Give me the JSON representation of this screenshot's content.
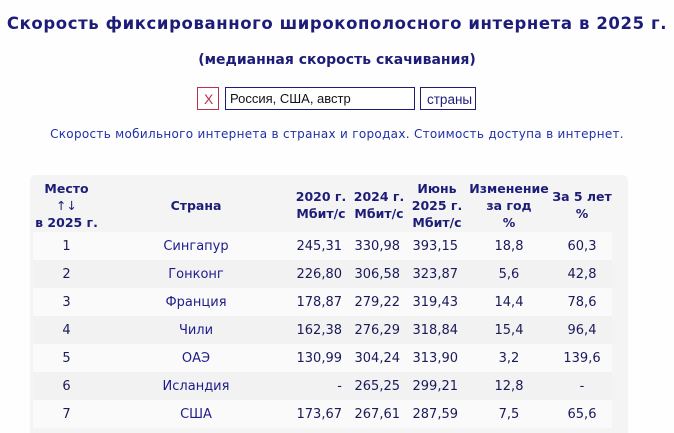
{
  "title": "Скорость фиксированного широкополосного интернета в 2025 г.",
  "subtitle": "(медианная скорость скачивания)",
  "search": {
    "clear_label": "X",
    "value": "Россия, США, австр",
    "button_label": "страны"
  },
  "info_text": "Скорость мобильного интернета в странах и городах. Стоимость доступа в интернет.",
  "table": {
    "headers": {
      "rank_line1": "Место",
      "rank_sort_icon": "↑↓",
      "rank_line2": "в 2025 г.",
      "country": "Страна",
      "y2020_line1": "2020 г.",
      "y2020_line2": "Мбит/с",
      "y2024_line1": "2024 г.",
      "y2024_line2": "Мбит/с",
      "june_line1": "Июнь",
      "june_line2": "2025 г.",
      "june_line3": "Мбит/с",
      "change_line1": "Изменение",
      "change_line2": "за год",
      "change_line3": "%",
      "five_line1": "За 5 лет",
      "five_line2": "%"
    },
    "rows": [
      {
        "rank": "1",
        "country": "Сингапур",
        "y2020": "245,31",
        "y2024": "330,98",
        "june2025": "393,15",
        "change": "18,8",
        "five": "60,3"
      },
      {
        "rank": "2",
        "country": "Гонконг",
        "y2020": "226,80",
        "y2024": "306,58",
        "june2025": "323,87",
        "change": "5,6",
        "five": "42,8"
      },
      {
        "rank": "3",
        "country": "Франция",
        "y2020": "178,87",
        "y2024": "279,22",
        "june2025": "319,43",
        "change": "14,4",
        "five": "78,6"
      },
      {
        "rank": "4",
        "country": "Чили",
        "y2020": "162,38",
        "y2024": "276,29",
        "june2025": "318,84",
        "change": "15,4",
        "five": "96,4"
      },
      {
        "rank": "5",
        "country": "ОАЭ",
        "y2020": "130,99",
        "y2024": "304,24",
        "june2025": "313,90",
        "change": "3,2",
        "five": "139,6"
      },
      {
        "rank": "6",
        "country": "Исландия",
        "y2020": "-",
        "y2024": "265,25",
        "june2025": "299,21",
        "change": "12,8",
        "five": "-"
      },
      {
        "rank": "7",
        "country": "США",
        "y2020": "173,67",
        "y2024": "267,61",
        "june2025": "287,59",
        "change": "7,5",
        "five": "65,6"
      }
    ]
  }
}
